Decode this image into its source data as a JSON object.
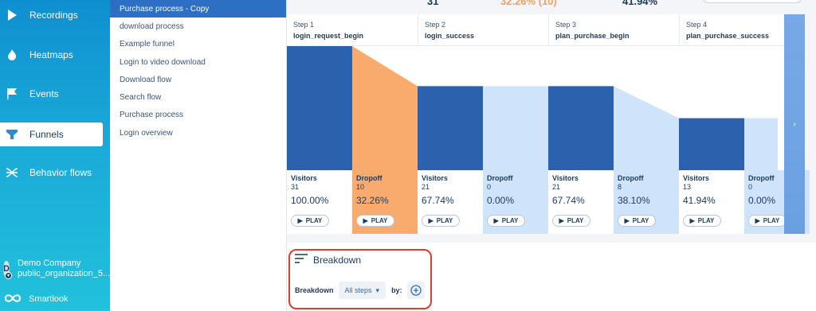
{
  "nav": {
    "items": [
      {
        "label": "Recordings",
        "icon": "play-icon"
      },
      {
        "label": "Heatmaps",
        "icon": "flame-icon"
      },
      {
        "label": "Events",
        "icon": "flag-icon"
      },
      {
        "label": "Funnels",
        "icon": "funnel-icon"
      },
      {
        "label": "Behavior flows",
        "icon": "flows-icon"
      }
    ],
    "active": "Funnels",
    "org": {
      "avatar": "D",
      "name": "Demo Company",
      "sub": "public_organization_5..."
    },
    "brand": "Smartlook"
  },
  "funnels": {
    "items": [
      "Purchase process - Copy",
      "download process",
      "Example funnel",
      "Login to video download",
      "Download flow",
      "Search flow",
      "Purchase process",
      "Login overview"
    ],
    "selected": "Purchase process - Copy"
  },
  "summary": {
    "total": "31",
    "dropoff": "32.26% (10)",
    "conversion": "41.94%"
  },
  "steps": [
    {
      "step": "Step 1",
      "name": "login_request_begin",
      "visitors": 31,
      "visitors_pct": "100.00%",
      "dropoff": 10,
      "dropoff_pct": "32.26%"
    },
    {
      "step": "Step 2",
      "name": "login_success",
      "visitors": 21,
      "visitors_pct": "67.74%",
      "dropoff": 0,
      "dropoff_pct": "0.00%"
    },
    {
      "step": "Step 3",
      "name": "plan_purchase_begin",
      "visitors": 21,
      "visitors_pct": "67.74%",
      "dropoff": 8,
      "dropoff_pct": "38.10%"
    },
    {
      "step": "Step 4",
      "name": "plan_purchase_success",
      "visitors": 13,
      "visitors_pct": "41.94%",
      "dropoff": 0,
      "dropoff_pct": "0.00%"
    }
  ],
  "labels": {
    "visitors": "Visitors",
    "dropoff": "Dropoff",
    "play": "PLAY",
    "next": "›"
  },
  "breakdown": {
    "title": "Breakdown",
    "label": "Breakdown",
    "value": "All steps",
    "by": "by:"
  },
  "colors": {
    "visitors": "#2c62ad",
    "dropoff_active": "#f9ab6e",
    "dropoff": "#cfe3fb",
    "flow": "#d6e7fc"
  }
}
